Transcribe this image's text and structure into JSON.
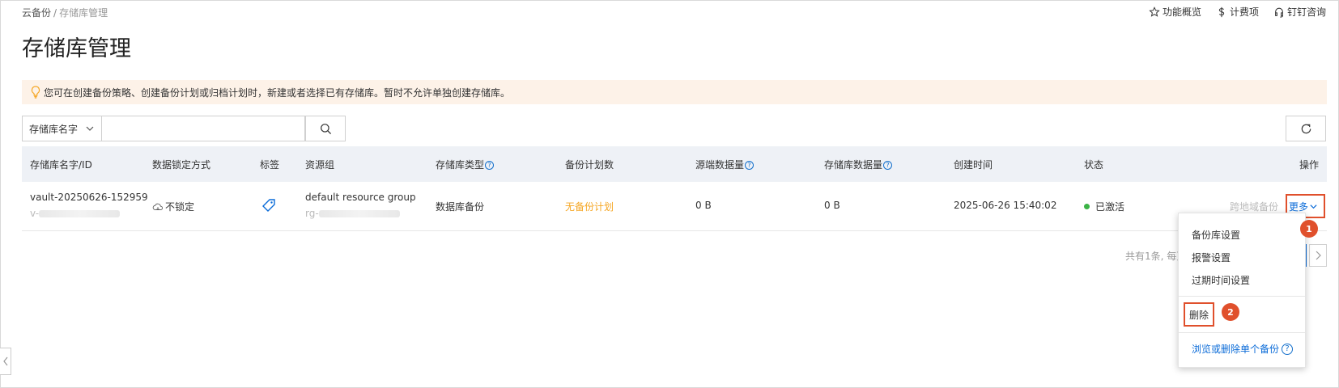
{
  "breadcrumb": {
    "root": "云备份",
    "separator": "/",
    "current": "存储库管理"
  },
  "top_links": {
    "overview": "功能概览",
    "billing": "计费项",
    "dingtalk": "钉钉咨询"
  },
  "page_title": "存储库管理",
  "notice": "您可在创建备份策略、创建备份计划或归档计划时，新建或者选择已有存储库。暂时不允许单独创建存储库。",
  "search": {
    "select_value": "存储库名字",
    "input_value": ""
  },
  "table": {
    "headers": {
      "name_id": "存储库名字/ID",
      "lock_mode": "数据锁定方式",
      "tags": "标签",
      "resource_group": "资源组",
      "vault_type": "存储库类型",
      "plan_count": "备份计划数",
      "source_data": "源端数据量",
      "vault_data": "存储库数据量",
      "created": "创建时间",
      "status": "状态",
      "actions": "操作"
    },
    "help_glyph": "?",
    "row": {
      "name": "vault-20250626-152959",
      "id_prefix": "v-",
      "lock_mode": "不锁定",
      "resource_group": "default resource group",
      "rg_id_prefix": "rg-",
      "vault_type": "数据库备份",
      "plan_count": "无备份计划",
      "source_data": "0 B",
      "vault_data": "0 B",
      "created": "2025-06-26 15:40:02",
      "status": "已激活",
      "cross_region": "跨地域备份",
      "more": "更多"
    }
  },
  "pagination": {
    "text": "共有1条, 每页"
  },
  "dropdown": {
    "items": [
      "备份库设置",
      "报警设置",
      "过期时间设置"
    ],
    "delete": "删除",
    "browse_delete": "浏览或删除单个备份"
  },
  "badges": [
    "1",
    "2"
  ],
  "colors": {
    "accent": "#0a6bd8",
    "highlight": "#e0502c",
    "warning_text": "#f5a623",
    "active": "#3bb346",
    "notice_bg": "#fdf2e8"
  }
}
